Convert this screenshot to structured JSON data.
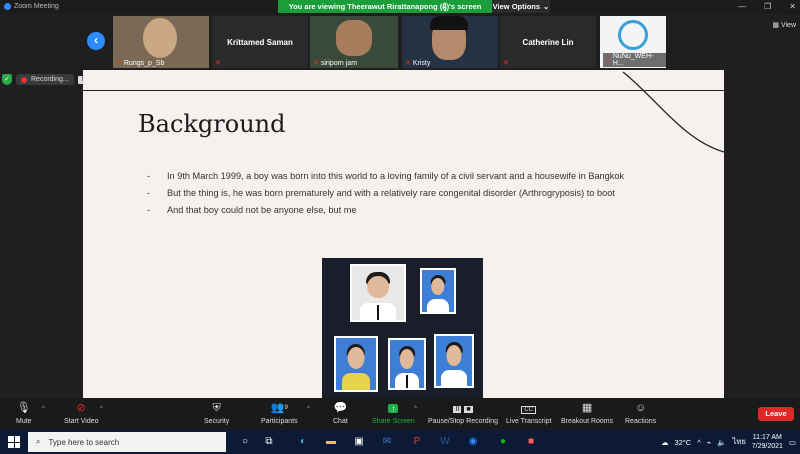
{
  "window": {
    "app_title": "Zoom Meeting",
    "share_banner": "You are viewing Theerawut Rirattanapong (ผู้)'s screen",
    "view_options": "View Options"
  },
  "gallery": {
    "participants": [
      {
        "name": "Rungs_p_Sb",
        "big_name": ""
      },
      {
        "name": "",
        "big_name": "Krittamed Saman"
      },
      {
        "name": "siriporn jam",
        "big_name": ""
      },
      {
        "name": "Kristy",
        "big_name": ""
      },
      {
        "name": "",
        "big_name": "Catherine Lin"
      },
      {
        "name": "NuNu_WEH-H...",
        "big_name": ""
      }
    ],
    "view_label": "View"
  },
  "recording": {
    "label": "Recording...",
    "pause": "II",
    "stop": "■"
  },
  "slide": {
    "title": "Background",
    "bullets": [
      "In 9th March 1999, a boy was born into this world to a loving family of a civil servant and a housewife in Bangkok",
      "But the thing is, he was born prematurely and with a relatively rare congenital disorder (Arthrogryposis) to boot",
      "And that boy could not be anyone else, but me"
    ]
  },
  "toolbar": {
    "mute": "Mute",
    "start_video": "Start Video",
    "security": "Security",
    "participants": "Participants",
    "participants_count": "9",
    "chat": "Chat",
    "share_screen": "Share Screen",
    "pause_stop_recording": "Pause/Stop Recording",
    "live_transcript": "Live Transcript",
    "breakout_rooms": "Breakout Rooms",
    "reactions": "Reactions",
    "leave": "Leave",
    "cc": "CC"
  },
  "taskbar": {
    "search_placeholder": "Type here to search",
    "temperature": "32°C",
    "language": "ไทย",
    "time": "11:17 AM",
    "date": "7/29/2021"
  },
  "colors": {
    "accent": "#2d8cff",
    "share_green": "#1a9e3a",
    "leave_red": "#e02828",
    "taskbar": "#0c1a35"
  }
}
